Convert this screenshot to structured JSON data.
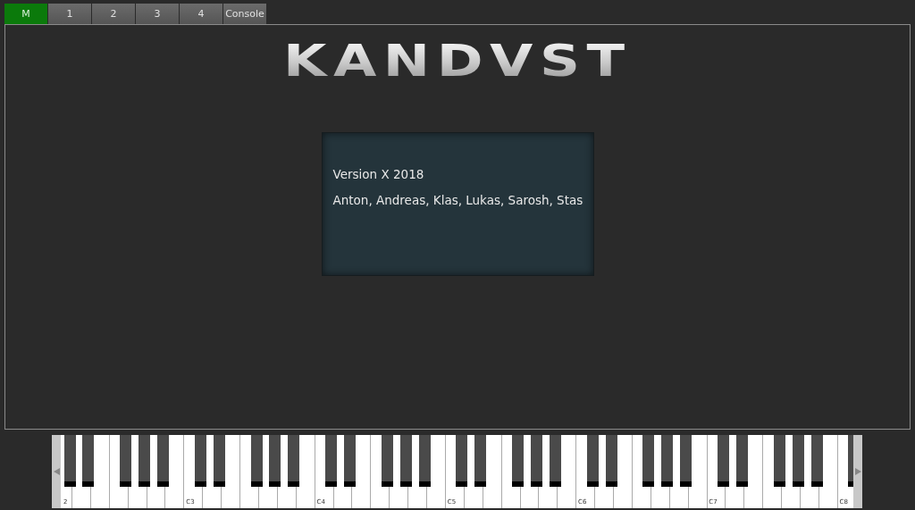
{
  "tabs": [
    {
      "label": "M",
      "selected": true
    },
    {
      "label": "1",
      "selected": false
    },
    {
      "label": "2",
      "selected": false
    },
    {
      "label": "3",
      "selected": false
    },
    {
      "label": "4",
      "selected": false
    },
    {
      "label": "Console",
      "selected": false
    }
  ],
  "logo": "KANDVST",
  "about": {
    "version": "Version X 2018",
    "authors": "Anton, Andreas, Klas, Lukas, Sarosh, Stas"
  },
  "keyboard": {
    "octave_labels": [
      "2",
      "C3",
      "C4",
      "C5",
      "C6",
      "C7",
      "C8"
    ]
  }
}
